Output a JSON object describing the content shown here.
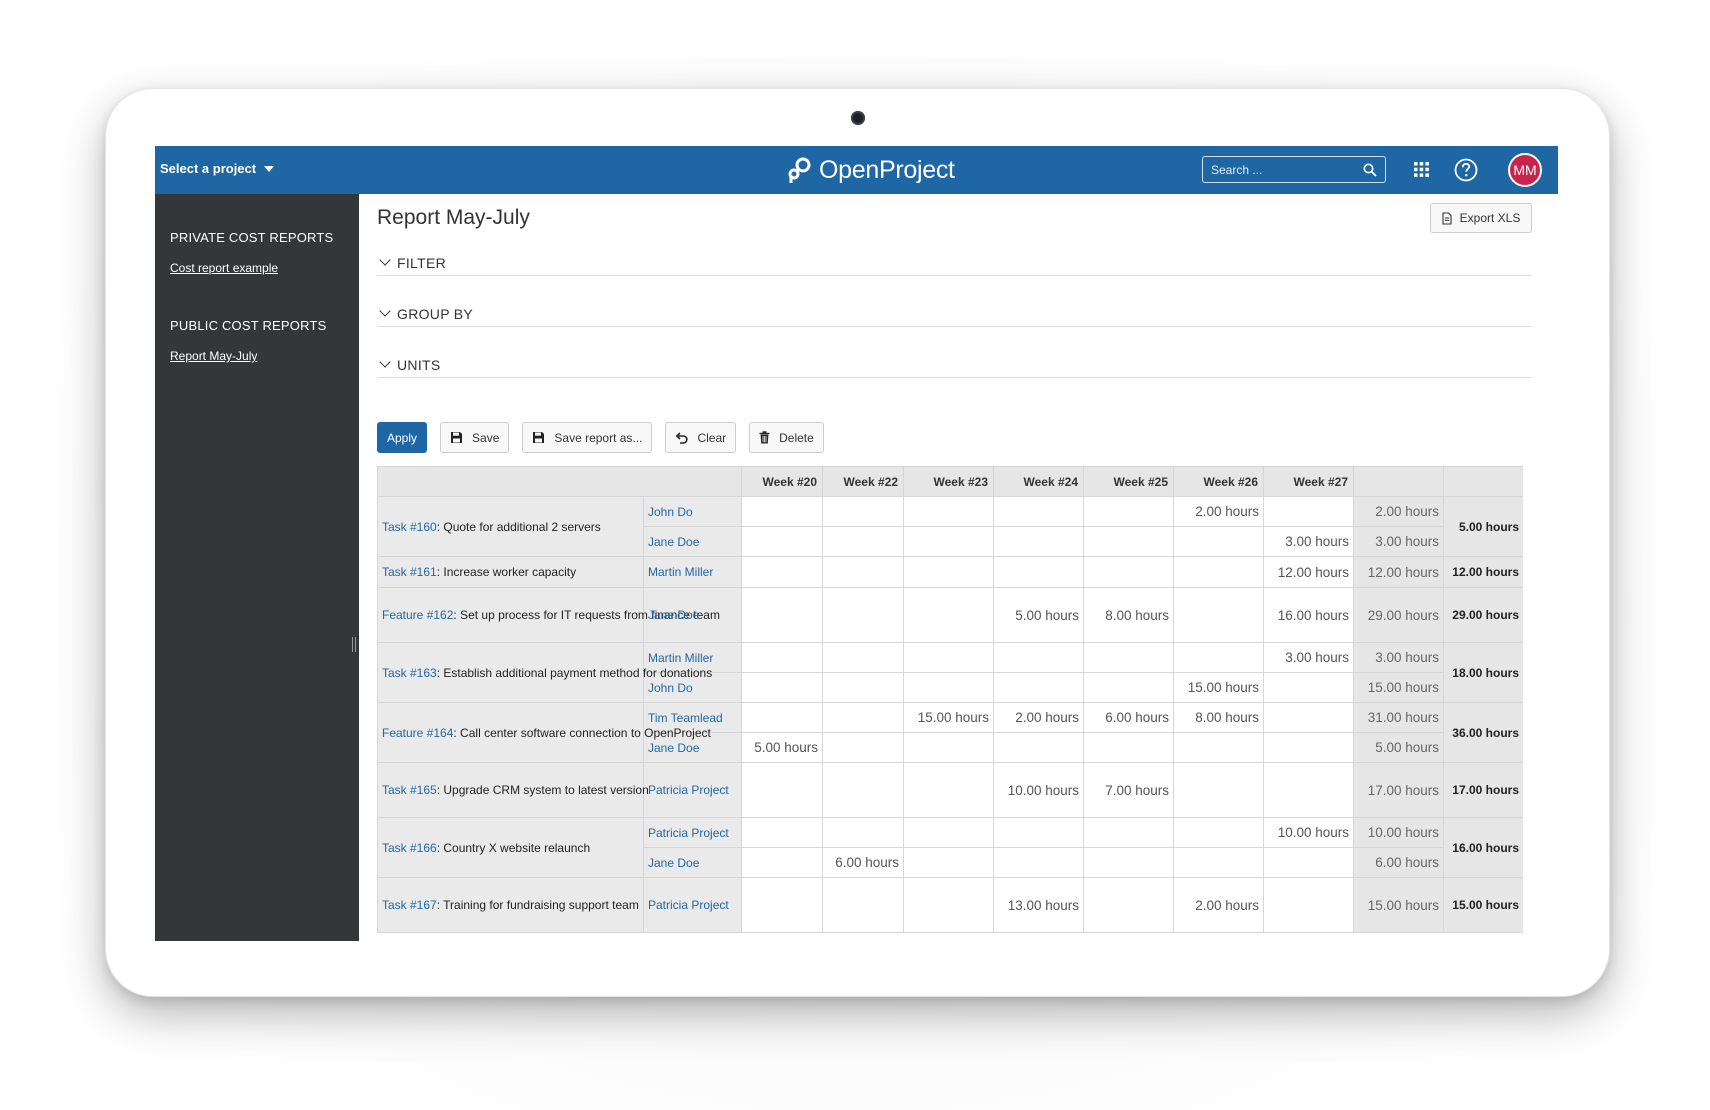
{
  "header": {
    "project_select": "Select a project",
    "logo_text": "OpenProject",
    "search_placeholder": "Search ...",
    "avatar_initials": "MM",
    "brand_color": "#1f67a4"
  },
  "sidebar": {
    "private_heading": "PRIVATE COST REPORTS",
    "private_items": [
      "Cost report example"
    ],
    "public_heading": "PUBLIC COST REPORTS",
    "public_items": [
      "Report May-July"
    ]
  },
  "main": {
    "title": "Report May-July",
    "export_label": "Export XLS",
    "sections": [
      "FILTER",
      "GROUP BY",
      "UNITS"
    ],
    "buttons": {
      "apply": "Apply",
      "save": "Save",
      "save_as": "Save report as...",
      "clear": "Clear",
      "delete": "Delete"
    }
  },
  "table": {
    "weeks": [
      "Week #20",
      "Week #22",
      "Week #23",
      "Week #24",
      "Week #25",
      "Week #26",
      "Week #27"
    ],
    "groups": [
      {
        "id": "Task #160",
        "title": ": Quote for additional 2 servers",
        "total": "5.00 hours",
        "rows": [
          {
            "user": "John Do",
            "values": [
              "",
              "",
              "",
              "",
              "",
              "2.00 hours",
              ""
            ],
            "sum": "2.00 hours"
          },
          {
            "user": "Jane Doe",
            "values": [
              "",
              "",
              "",
              "",
              "",
              "",
              "3.00 hours"
            ],
            "sum": "3.00 hours"
          }
        ]
      },
      {
        "id": "Task #161",
        "title": ": Increase worker capacity",
        "total": "12.00 hours",
        "rows": [
          {
            "user": "Martin Miller",
            "values": [
              "",
              "",
              "",
              "",
              "",
              "",
              "12.00 hours"
            ],
            "sum": "12.00 hours"
          }
        ]
      },
      {
        "id": "Feature #162",
        "title": ": Set up process for IT requests from finance team",
        "total": "29.00 hours",
        "rows": [
          {
            "user": "Jane Doe",
            "values": [
              "",
              "",
              "",
              "5.00 hours",
              "8.00 hours",
              "",
              "16.00 hours"
            ],
            "sum": "29.00 hours"
          }
        ]
      },
      {
        "id": "Task #163",
        "title": ": Establish additional payment method for donations",
        "total": "18.00 hours",
        "rows": [
          {
            "user": "Martin Miller",
            "values": [
              "",
              "",
              "",
              "",
              "",
              "",
              "3.00 hours"
            ],
            "sum": "3.00 hours"
          },
          {
            "user": "John Do",
            "values": [
              "",
              "",
              "",
              "",
              "",
              "15.00 hours",
              ""
            ],
            "sum": "15.00 hours"
          }
        ]
      },
      {
        "id": "Feature #164",
        "title": ": Call center software connection to OpenProject",
        "total": "36.00 hours",
        "rows": [
          {
            "user": "Tim Teamlead",
            "values": [
              "",
              "",
              "15.00 hours",
              "2.00 hours",
              "6.00 hours",
              "8.00 hours",
              ""
            ],
            "sum": "31.00 hours"
          },
          {
            "user": "Jane Doe",
            "values": [
              "5.00 hours",
              "",
              "",
              "",
              "",
              "",
              ""
            ],
            "sum": "5.00 hours"
          }
        ]
      },
      {
        "id": "Task #165",
        "title": ": Upgrade CRM system to latest version",
        "total": "17.00 hours",
        "rows": [
          {
            "user": "Patricia Project",
            "values": [
              "",
              "",
              "",
              "10.00 hours",
              "7.00 hours",
              "",
              ""
            ],
            "sum": "17.00 hours"
          }
        ]
      },
      {
        "id": "Task #166",
        "title": ": Country X website relaunch",
        "total": "16.00 hours",
        "rows": [
          {
            "user": "Patricia Project",
            "values": [
              "",
              "",
              "",
              "",
              "",
              "",
              "10.00 hours"
            ],
            "sum": "10.00 hours"
          },
          {
            "user": "Jane Doe",
            "values": [
              "",
              "6.00 hours",
              "",
              "",
              "",
              "",
              ""
            ],
            "sum": "6.00 hours"
          }
        ]
      },
      {
        "id": "Task #167",
        "title": ": Training for fundraising support team",
        "total": "15.00 hours",
        "rows": [
          {
            "user": "Patricia Project",
            "values": [
              "",
              "",
              "",
              "13.00 hours",
              "",
              "2.00 hours",
              ""
            ],
            "sum": "15.00 hours"
          }
        ]
      }
    ]
  }
}
